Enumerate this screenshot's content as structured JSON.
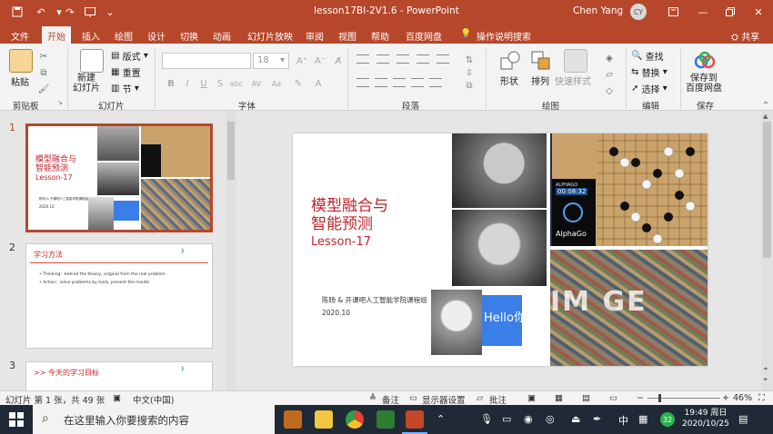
{
  "title_bar": {
    "doc_title": "lesson17BI-2V1.6  -  PowerPoint",
    "user_name": "Chen Yang",
    "user_initials": "CY"
  },
  "tabs": [
    "文件",
    "开始",
    "插入",
    "绘图",
    "设计",
    "切换",
    "动画",
    "幻灯片放映",
    "审阅",
    "视图",
    "帮助",
    "百度网盘",
    "操作说明搜索"
  ],
  "share_label": "共享",
  "ribbon": {
    "paste": "粘贴",
    "new_slide": "新建\n幻灯片",
    "layout": "版式",
    "reset": "重置",
    "section": "节",
    "font_size": "18",
    "shapes": "形状",
    "arrange": "排列",
    "quick_styles": "快速样式",
    "find": "查找",
    "replace": "替换",
    "select": "选择",
    "save_to_baidu": "保存到\n百度网盘",
    "groups": {
      "clipboard": "剪贴板",
      "slides": "幻灯片",
      "font": "字体",
      "paragraph": "段落",
      "drawing": "绘图",
      "editing": "编辑",
      "save": "保存"
    }
  },
  "thumbnails": [
    {
      "num": "1",
      "title_cn": "模型融合与\n智能预测",
      "title_en": "Lesson-17",
      "author": "陈旸 & 开课吧人工智能学院课程组",
      "date": "2020.10"
    },
    {
      "num": "2",
      "title": "学习方法",
      "bullets": [
        "• Thinking：behind the theory, original from the real problem",
        "• Action：solve problems by tools, present the results"
      ]
    },
    {
      "num": "3",
      "title": ">>  今天的学习目标"
    }
  ],
  "slide": {
    "title_cn": "模型融合与\n智能预测",
    "title_en": "Lesson-17",
    "author": "陈旸 & 开课吧人工智能学院课程组",
    "date": "2020.10",
    "hello_text": "Hello你好",
    "image_text": "IM  GE",
    "alphago_label": "ALPHAGO",
    "alphago_time": "00:08:32",
    "alphago_brand": "AlphaGo"
  },
  "status_bar": {
    "slide_info": "幻灯片 第 1 张，共 49 张",
    "language": "中文(中国)",
    "notes": "备注",
    "display_settings": "显示器设置",
    "comments": "批注",
    "zoom": "46%"
  },
  "taskbar": {
    "search_placeholder": "在这里输入你要搜索的内容",
    "ime": "中",
    "badge": "32",
    "time": "19:49 周日",
    "date": "2020/10/25"
  },
  "colors": {
    "accent": "#b7472a",
    "slide_title": "#c0242b",
    "taskbar": "#1f2a36"
  }
}
